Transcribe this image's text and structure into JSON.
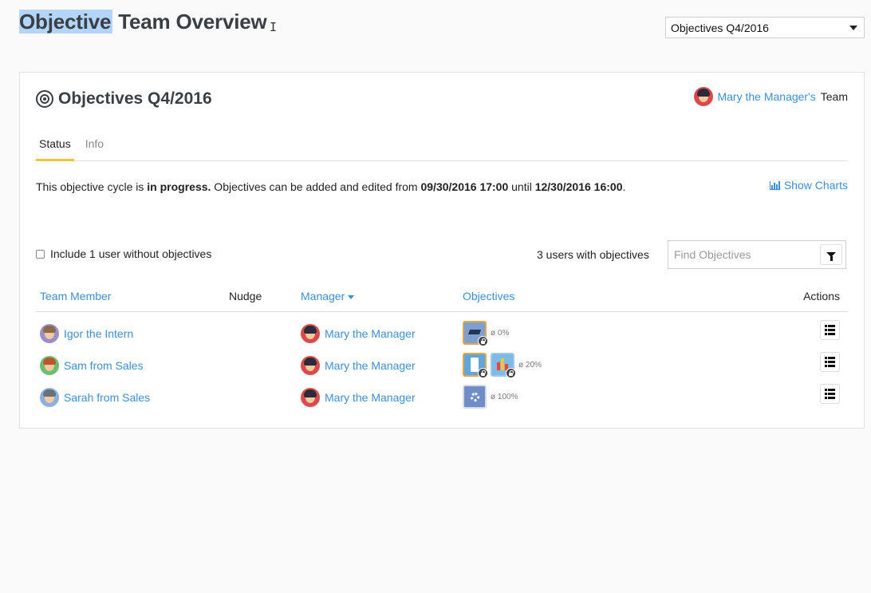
{
  "page": {
    "title_selected": "Objective",
    "title_rest": " Team Overview",
    "cursor_glyph": "I"
  },
  "cycle_select": {
    "value": "Objectives Q4/2016"
  },
  "panel": {
    "title": "Objectives Q4/2016",
    "team_owner_link": "Mary the Manager's",
    "team_owner_suffix": "Team",
    "tabs": [
      {
        "label": "Status",
        "active": true
      },
      {
        "label": "Info",
        "active": false
      }
    ],
    "status": {
      "prefix": "This objective cycle is ",
      "state": "in progress.",
      "middle": " Objectives can be added and edited from ",
      "start": "09/30/2016 17:00",
      "until": " until ",
      "end": "12/30/2016 16:00",
      "suffix": "."
    },
    "show_charts_label": "Show Charts",
    "include_label": "Include 1 user without objectives",
    "users_count": "3 users with objectives",
    "search_placeholder": "Find Objectives",
    "columns": {
      "member": "Team Member",
      "nudge": "Nudge",
      "manager": "Manager",
      "objectives": "Objectives",
      "actions": "Actions"
    },
    "rows": [
      {
        "member": "Igor the Intern",
        "manager": "Mary the Manager",
        "avg": "ø 0%"
      },
      {
        "member": "Sam from Sales",
        "manager": "Mary the Manager",
        "avg": "ø 20%"
      },
      {
        "member": "Sarah from Sales",
        "manager": "Mary the Manager",
        "avg": "ø 100%"
      }
    ]
  },
  "colors": {
    "link": "#3c8fd6",
    "tab_active": "#f0c23a",
    "selection": "#b4d5fa"
  },
  "icons": [
    "target-icon",
    "bar-chart-icon",
    "filter-icon",
    "list-icon",
    "lock-icon",
    "caret-down-icon"
  ]
}
